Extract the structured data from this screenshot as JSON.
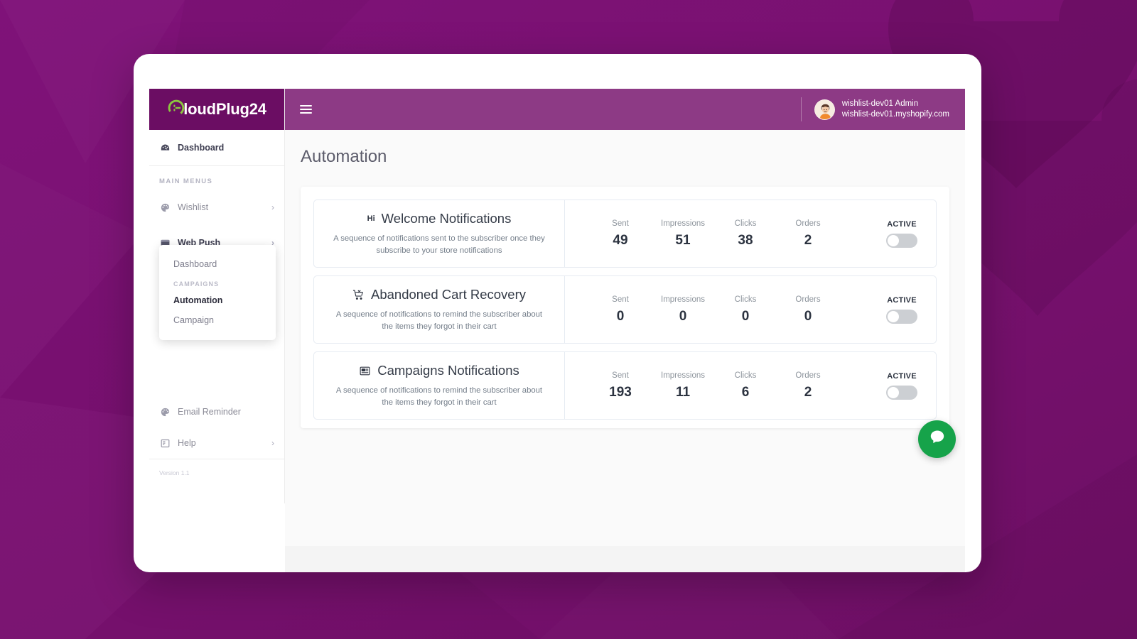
{
  "brand": {
    "name_prefix": "C",
    "name": "loudPlug24",
    "full_name": "CloudPlug24",
    "logo_green": "#8cc63f",
    "header_bg": "#6b0d63",
    "topbar_bg": "#8d3a85"
  },
  "topbar": {
    "menu_icon": "hamburger-icon",
    "user_name": "wishlist-dev01 Admin",
    "user_domain": "wishlist-dev01.myshopify.com",
    "avatar_icon": "user-avatar"
  },
  "sidebar": {
    "dashboard": {
      "label": "Dashboard",
      "icon": "speedometer-icon"
    },
    "section_caption": "MAIN MENUS",
    "items": [
      {
        "label": "Wishlist",
        "icon": "palette-icon",
        "chevron": "›",
        "expanded": false
      },
      {
        "label": "Web Push",
        "icon": "browser-window-icon",
        "chevron": "›",
        "expanded": true
      }
    ],
    "submenu": {
      "dashboard_label": "Dashboard",
      "caption": "CAMPAIGNS",
      "items": [
        {
          "label": "Automation",
          "active": true
        },
        {
          "label": "Campaign",
          "active": false
        }
      ]
    },
    "bottom_items": [
      {
        "label": "Email Reminder",
        "icon": "palette-icon",
        "chevron": ""
      },
      {
        "label": "Help",
        "icon": "book-icon",
        "chevron": "›"
      }
    ],
    "version": "Version 1.1"
  },
  "main": {
    "page_title": "Automation",
    "stat_labels": [
      "Sent",
      "Impressions",
      "Clicks",
      "Orders"
    ],
    "toggle_label": "ACTIVE",
    "cards": [
      {
        "badge": "Hi",
        "icon": "hi-text-badge",
        "title": "Welcome Notifications",
        "description": "A sequence of notifications sent to the subscriber once they subscribe to your store notifications",
        "stats": {
          "sent": "49",
          "impressions": "51",
          "clicks": "38",
          "orders": "2"
        },
        "toggle_label": "ACTIVE",
        "toggle_on": false
      },
      {
        "badge": "",
        "icon": "cart-x-icon",
        "title": "Abandoned Cart Recovery",
        "description": "A sequence of notifications to remind the subscriber about the items they forgot in their cart",
        "stats": {
          "sent": "0",
          "impressions": "0",
          "clicks": "0",
          "orders": "0"
        },
        "toggle_label": "ACTIVE",
        "toggle_on": false
      },
      {
        "badge": "",
        "icon": "campaign-card-icon",
        "title": "Campaigns Notifications",
        "description": "A sequence of notifications to remind the subscriber about the items they forgot in their cart",
        "stats": {
          "sent": "193",
          "impressions": "11",
          "clicks": "6",
          "orders": "2"
        },
        "toggle_label": "ACTIVE",
        "toggle_on": false
      }
    ]
  },
  "chat": {
    "icon": "chat-bubble-icon",
    "color": "#16a34a"
  }
}
